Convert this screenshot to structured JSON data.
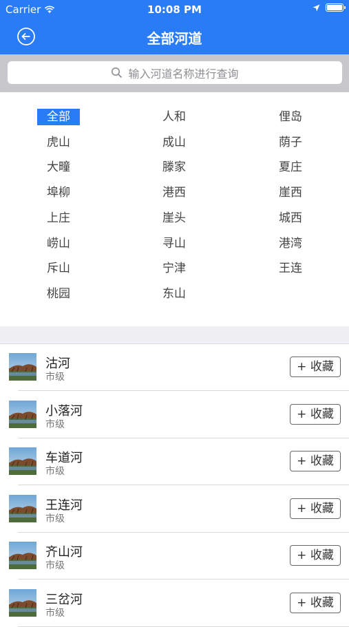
{
  "status_bar": {
    "carrier": "Carrier",
    "time": "10:08 PM"
  },
  "header": {
    "title": "全部河道"
  },
  "search": {
    "placeholder": "输入河道名称进行查询"
  },
  "districts": [
    [
      "全部",
      "人和",
      "俚岛"
    ],
    [
      "虎山",
      "成山",
      "荫子"
    ],
    [
      "大疃",
      "滕家",
      "夏庄"
    ],
    [
      "埠柳",
      "港西",
      "崖西"
    ],
    [
      "上庄",
      "崖头",
      "城西"
    ],
    [
      "崂山",
      "寻山",
      "港湾"
    ],
    [
      "斥山",
      "宁津",
      "王连"
    ],
    [
      "桃园",
      "东山"
    ]
  ],
  "rivers": [
    {
      "name": "沽河",
      "level": "市级",
      "action": "+ 收藏"
    },
    {
      "name": "小落河",
      "level": "市级",
      "action": "+ 收藏"
    },
    {
      "name": "车道河",
      "level": "市级",
      "action": "+ 收藏"
    },
    {
      "name": "王连河",
      "level": "市级",
      "action": "+ 收藏"
    },
    {
      "name": "齐山河",
      "level": "市级",
      "action": "+ 收藏"
    },
    {
      "name": "三岔河",
      "level": "市级",
      "action": "+ 收藏"
    }
  ],
  "colors": {
    "primary": "#2a7cf6",
    "search_bg": "#c8c8cc",
    "separator_bg": "#efeff4"
  }
}
